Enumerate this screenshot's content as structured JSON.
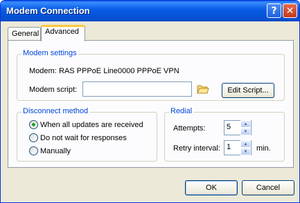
{
  "window": {
    "title": "Modem Connection"
  },
  "tabs": [
    {
      "label": "General"
    },
    {
      "label": "Advanced"
    }
  ],
  "modem_settings": {
    "group_label": "Modem settings",
    "modem_label": "Modem:",
    "modem_value": "RAS PPPoE Line0000 PPPoE VPN",
    "script_label": "Modem script:",
    "script_value": "",
    "edit_script_label": "Edit Script..."
  },
  "disconnect": {
    "group_label": "Disconnect method",
    "options": [
      {
        "label": "When all updates are received",
        "selected": true
      },
      {
        "label": "Do not wait for responses",
        "selected": false
      },
      {
        "label": "Manually",
        "selected": false
      }
    ]
  },
  "redial": {
    "group_label": "Redial",
    "attempts_label": "Attempts:",
    "attempts_value": "5",
    "retry_label": "Retry interval:",
    "retry_value": "1",
    "retry_unit": "min."
  },
  "footer": {
    "ok_label": "OK",
    "cancel_label": "Cancel"
  },
  "icons": {
    "help": "help-icon",
    "close": "close-icon",
    "folder": "folder-icon",
    "spin_up": "spin-up-icon",
    "spin_down": "spin-down-icon"
  }
}
